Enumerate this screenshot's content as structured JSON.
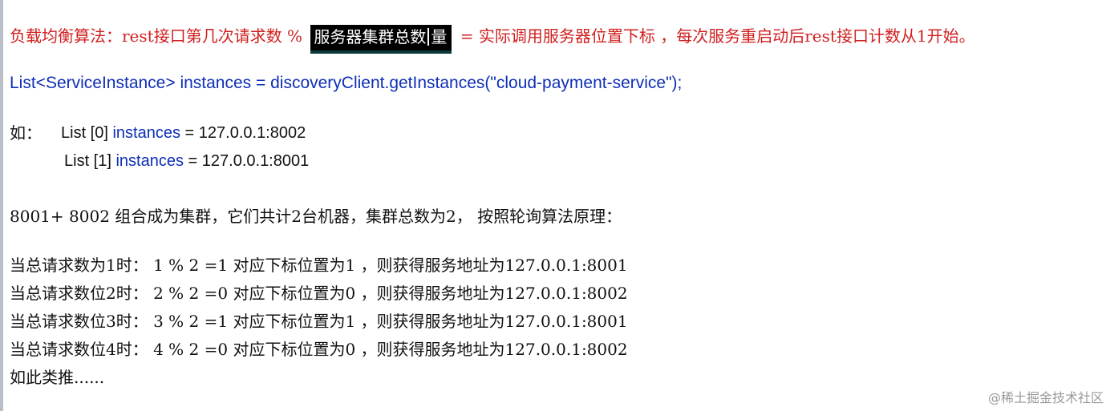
{
  "algo_line": {
    "prefix": "负载均衡算法：rest接口第几次请求数 % ",
    "highlight_pre": "服务器集群总数",
    "highlight_post": "量",
    "suffix": " = 实际调用服务器位置下标 ，每次服务重启动后rest接口计数从1开始。"
  },
  "code_line": "List<ServiceInstance> instances = discoveryClient.getInstances(\"cloud-payment-service\");",
  "example": {
    "label": "如：",
    "rows": [
      {
        "prefix": "List [0] ",
        "kw": "instances",
        "value": " = 127.0.0.1:8002"
      },
      {
        "prefix": "List [1] ",
        "kw": "instances",
        "value": " = 127.0.0.1:8001"
      }
    ]
  },
  "cluster_line": "8001+ 8002 组合成为集群，它们共计2台机器，集群总数为2， 按照轮询算法原理：",
  "calc_rows": [
    "当总请求数为1时： 1 % 2 =1 对应下标位置为1 ，则获得服务地址为127.0.0.1:8001",
    "当总请求数位2时： 2 % 2 =0 对应下标位置为0 ，则获得服务地址为127.0.0.1:8002",
    "当总请求数位3时： 3 % 2 =1 对应下标位置为1 ，则获得服务地址为127.0.0.1:8001",
    "当总请求数位4时： 4 % 2 =0 对应下标位置为0 ，则获得服务地址为127.0.0.1:8002"
  ],
  "etc_line": "如此类推......",
  "watermark": "@稀土掘金技术社区",
  "colors": {
    "red_text": "#d11f1f",
    "blue_text": "#0e2fb7",
    "highlight_bg": "#000000"
  }
}
